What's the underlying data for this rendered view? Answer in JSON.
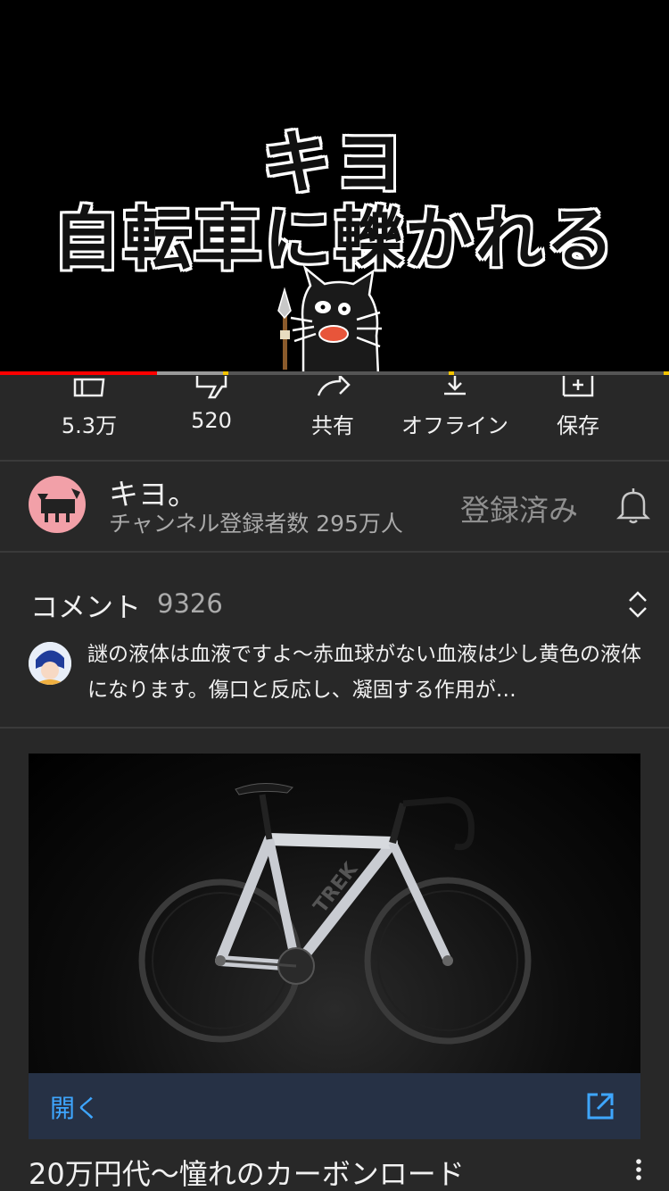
{
  "video": {
    "title_line1": "キヨ",
    "title_line2": "自転車に轢かれる",
    "progress_played": 0.235,
    "progress_buffered": 0.34
  },
  "actions": [
    {
      "icon": "thumbs-up-icon",
      "label": "5.3万"
    },
    {
      "icon": "thumbs-down-icon",
      "label": "520"
    },
    {
      "icon": "share-icon",
      "label": "共有"
    },
    {
      "icon": "download-icon",
      "label": "オフライン"
    },
    {
      "icon": "save-icon",
      "label": "保存"
    }
  ],
  "channel": {
    "name": "キヨ。",
    "subscribers": "チャンネル登録者数 295万人",
    "subscribed_label": "登録済み",
    "bell_icon": "bell-icon"
  },
  "comments": {
    "title": "コメント",
    "count": "9326",
    "top_comment": "謎の液体は血液ですよ〜赤血球がない血液は少し黄色の液体になります。傷口と反応し、凝固する作用が…"
  },
  "ad": {
    "open_label": "開く",
    "title": "20万円代〜憧れのカーボンロード",
    "bike_brand": "TREK"
  },
  "colors": {
    "background": "#282828",
    "progress_red": "#ff0000",
    "link_blue": "#3ea6ff",
    "ad_bar": "#263145"
  }
}
